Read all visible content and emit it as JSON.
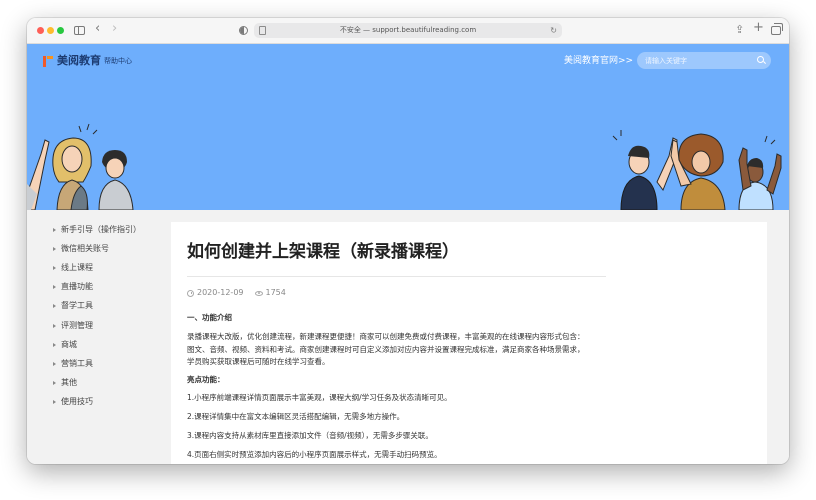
{
  "browser": {
    "url": "不安全 — support.beautifulreading.com"
  },
  "header": {
    "logo_text": "美阅教育",
    "logo_subtitle": "帮助中心",
    "official_link": "美阅教育官网>>",
    "search_placeholder": "请输入关键字",
    "hero_color": "#6eaefc"
  },
  "sidebar": {
    "items": [
      {
        "label": "新手引导（操作指引）"
      },
      {
        "label": "微信相关账号"
      },
      {
        "label": "线上课程"
      },
      {
        "label": "直播功能"
      },
      {
        "label": "督学工具"
      },
      {
        "label": "评测管理"
      },
      {
        "label": "商城"
      },
      {
        "label": "营销工具"
      },
      {
        "label": "其他"
      },
      {
        "label": "使用技巧"
      }
    ]
  },
  "article": {
    "title": "如何创建并上架课程（新录播课程）",
    "date": "2020-12-09",
    "views": "1754",
    "section1_heading": "一、功能介绍",
    "intro_lines": [
      "录播课程大改版，优化创建流程，新建课程更便捷！商家可以创建免费或付费课程，丰富美观的在线课程内容形式包含：",
      "图文、音频、视频、资料和考试。商家创建课程时可自定义添加对应内容并设置课程完成标准，满足商家各种场景需求，",
      "学员购买获取课程后可随时在线学习查看。"
    ],
    "highlights_heading": "亮点功能：",
    "highlights": [
      "1.小程序前端课程详情页面展示丰富美观，课程大纲/学习任务及状态清晰可见。",
      "2.课程详情集中在富文本编辑区灵活搭配编辑，无需多地方操作。",
      "3.课程内容支持从素材库里直接添加文件（音频/视频），无需多步骤关联。",
      "4.页面右侧实时预览添加内容后的小程序页面展示样式，无需手动扫码预览。"
    ]
  }
}
